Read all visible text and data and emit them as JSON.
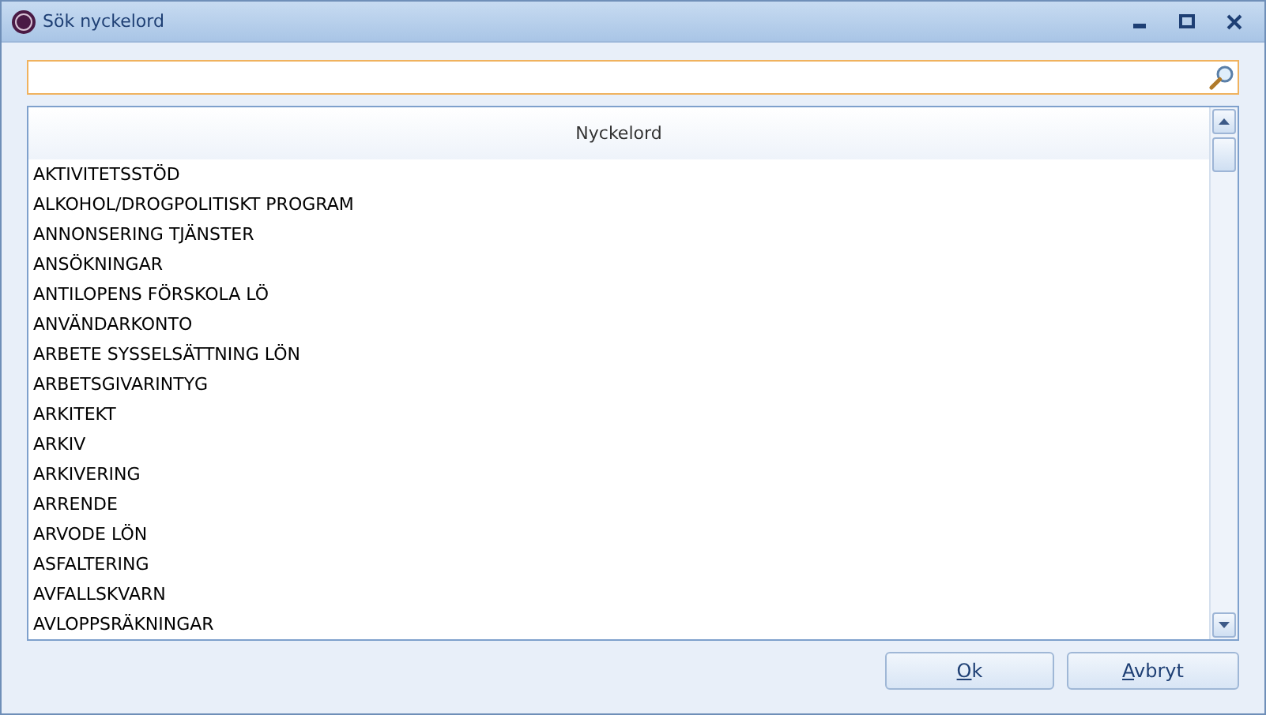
{
  "window": {
    "title": "Sök nyckelord"
  },
  "list": {
    "column": "Nyckelord",
    "rows": [
      "AKTIVITETSSTÖD",
      "ALKOHOL/DROGPOLITISKT PROGRAM",
      "ANNONSERING TJÄNSTER",
      "ANSÖKNINGAR",
      "ANTILOPENS FÖRSKOLA LÖ",
      "ANVÄNDARKONTO",
      "ARBETE SYSSELSÄTTNING LÖN",
      "ARBETSGIVARINTYG",
      "ARKITEKT",
      "ARKIV",
      "ARKIVERING",
      "ARRENDE",
      "ARVODE LÖN",
      "ASFALTERING",
      "AVFALLSKVARN",
      "AVLOPPSRÄKNINGAR"
    ]
  },
  "buttons": [
    "Ok",
    "Avbryt"
  ]
}
